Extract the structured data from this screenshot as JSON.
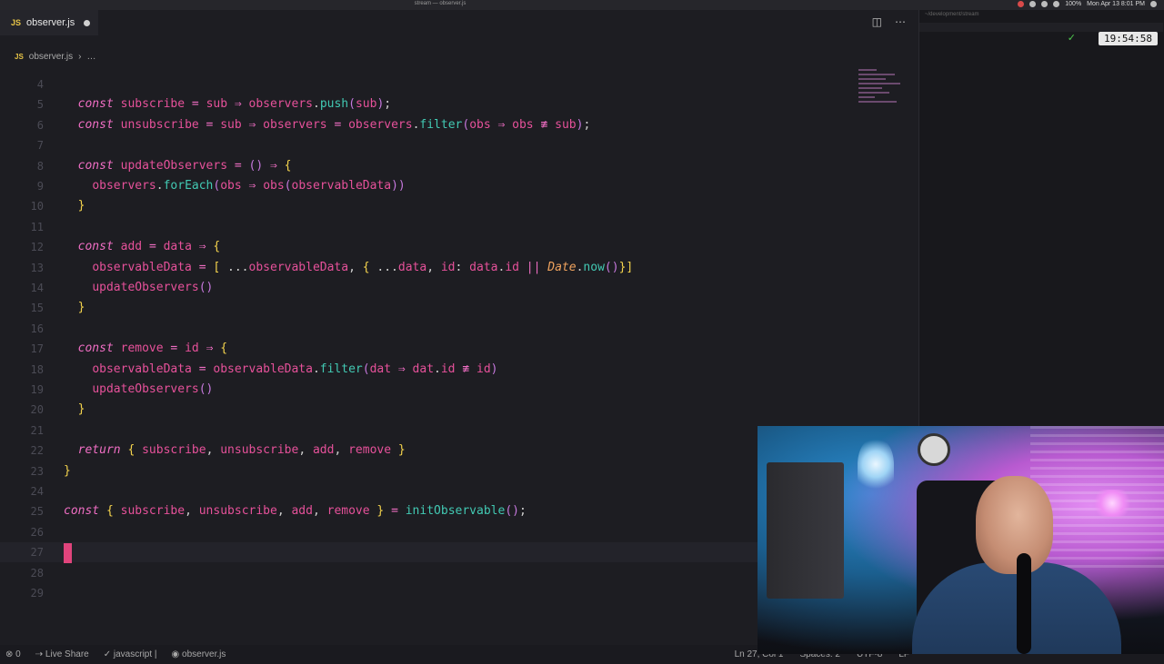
{
  "window": {
    "title": "stream — observer.js"
  },
  "menubar": {
    "battery": "100%",
    "datetime": "Mon Apr 13  8:01 PM"
  },
  "tabs": [
    {
      "icon": "JS",
      "label": "observer.js",
      "dirty": true
    }
  ],
  "breadcrumb": {
    "icon": "JS",
    "file": "observer.js",
    "more": "…"
  },
  "code": {
    "cursor_line": 27,
    "lines": [
      {
        "n": "4",
        "html": ""
      },
      {
        "n": "5",
        "html": ""
      },
      {
        "n": "6",
        "html": ""
      },
      {
        "n": "7",
        "html": ""
      },
      {
        "n": "8",
        "html": ""
      },
      {
        "n": "9",
        "html": ""
      },
      {
        "n": "10",
        "html": ""
      },
      {
        "n": "11",
        "html": ""
      },
      {
        "n": "12",
        "html": ""
      },
      {
        "n": "13",
        "html": ""
      },
      {
        "n": "14",
        "html": ""
      },
      {
        "n": "15",
        "html": ""
      },
      {
        "n": "16",
        "html": ""
      },
      {
        "n": "17",
        "html": ""
      },
      {
        "n": "18",
        "html": ""
      },
      {
        "n": "19",
        "html": ""
      },
      {
        "n": "20",
        "html": ""
      },
      {
        "n": "21",
        "html": ""
      },
      {
        "n": "22",
        "html": ""
      },
      {
        "n": "23",
        "html": ""
      },
      {
        "n": "24",
        "html": ""
      },
      {
        "n": "25",
        "html": ""
      },
      {
        "n": "26",
        "html": ""
      },
      {
        "n": "27",
        "html": ""
      },
      {
        "n": "28",
        "html": ""
      },
      {
        "n": "29",
        "html": ""
      }
    ],
    "text": [
      "",
      "  const subscribe = sub ⇒ observers.push(sub);",
      "  const unsubscribe = sub ⇒ observers = observers.filter(obs ⇒ obs ≢ sub);",
      "",
      "  const updateObservers = () ⇒ {",
      "    observers.forEach(obs ⇒ obs(observableData))",
      "  }",
      "",
      "  const add = data ⇒ {",
      "    observableData = [ ...observableData, { ...data, id: data.id || Date.now()}]",
      "    updateObservers()",
      "  }",
      "",
      "  const remove = id ⇒ {",
      "    observableData = observableData.filter(dat ⇒ dat.id ≢ id)",
      "    updateObservers()",
      "  }",
      "",
      "  return { subscribe, unsubscribe, add, remove }",
      "}",
      "",
      "const { subscribe, unsubscribe, add, remove } = initObservable();",
      "",
      "",
      "",
      ""
    ]
  },
  "statusbar": {
    "errors": "0",
    "live_share": "Live Share",
    "language": "javascript",
    "file": "observer.js",
    "position": "Ln 27, Col 1",
    "spaces": "Spaces: 2",
    "encoding": "UTF-8",
    "eol": "LF"
  },
  "sidepane": {
    "path": "~/development/stream",
    "clock": "19:54:58"
  }
}
